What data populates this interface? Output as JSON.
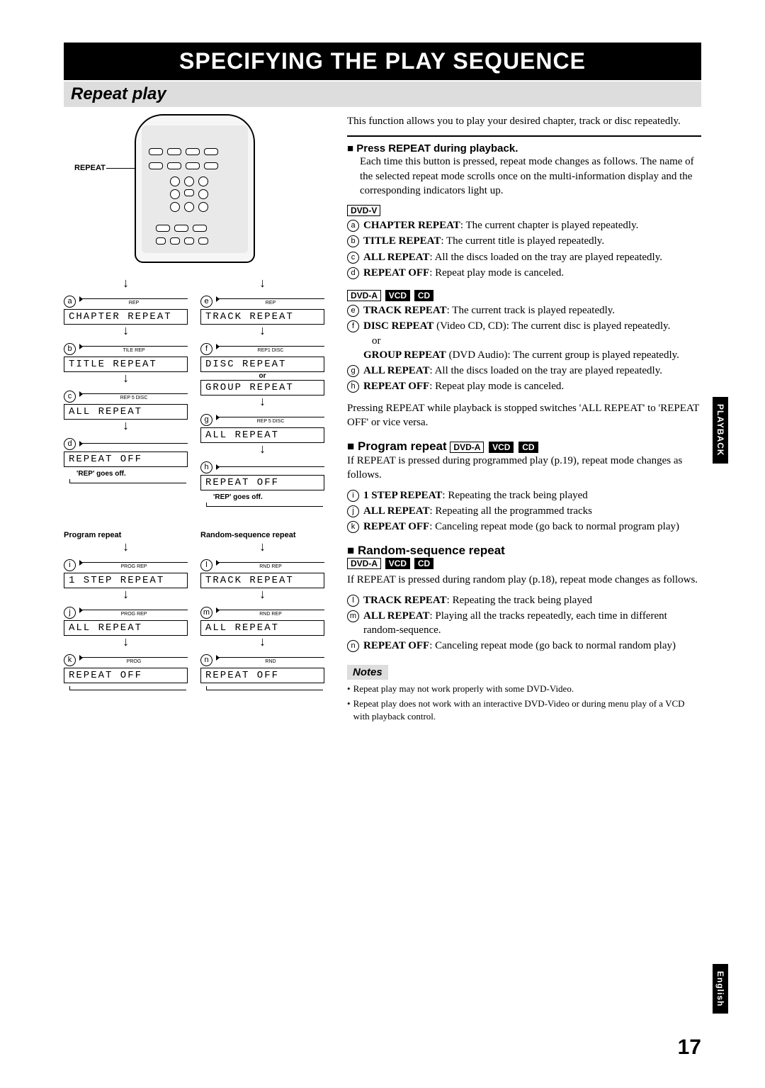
{
  "header": {
    "title": "SPECIFYING THE PLAY SEQUENCE"
  },
  "section": {
    "title": "Repeat play"
  },
  "remote": {
    "label": "REPEAT"
  },
  "flows": {
    "left1": {
      "a": "CHAPTER REPEAT",
      "b": "TITLE REPEAT",
      "c": "ALL REPEAT",
      "d": "REPEAT OFF",
      "off_note": "'REP' goes off.",
      "ind_a": "REP",
      "ind_b": "TILE       REP",
      "ind_c": "REP  5 DISC",
      "ind_d": ""
    },
    "right1": {
      "e": "TRACK REPEAT",
      "f": "DISC REPEAT",
      "f2_label": "or",
      "f2": "GROUP REPEAT",
      "g": "ALL REPEAT",
      "h": "REPEAT OFF",
      "off_note": "'REP' goes off.",
      "ind_e": "REP",
      "ind_f": "REP1  DISC",
      "ind_g": "REP  5 DISC",
      "ind_h": ""
    },
    "prog": {
      "title": "Program repeat",
      "i": "1 STEP REPEAT",
      "j": "ALL REPEAT",
      "k": "REPEAT OFF",
      "ind_i": "PROG    REP",
      "ind_j": "PROG    REP",
      "ind_k": "PROG"
    },
    "rnd": {
      "title": "Random-sequence repeat",
      "l": "TRACK REPEAT",
      "m": "ALL REPEAT",
      "n": "REPEAT OFF",
      "ind_l": "RND  REP",
      "ind_m": "RND  REP",
      "ind_n": "RND"
    }
  },
  "right": {
    "intro": "This function allows you to play your desired chapter, track or disc repeatedly.",
    "step_title": "Press REPEAT during playback.",
    "step_body": "Each time this button is pressed, repeat mode changes as follows. The name of the selected repeat mode scrolls once on the multi-information display and the corresponding indicators light up.",
    "formats": {
      "dvdv": "DVD-V",
      "dvda": "DVD-A",
      "vcd": "VCD",
      "cd": "CD"
    },
    "dvdv": {
      "a": {
        "label": "CHAPTER REPEAT",
        "desc": ": The current chapter is played repeatedly."
      },
      "b": {
        "label": "TITLE REPEAT",
        "desc": ": The current title is played repeatedly."
      },
      "c": {
        "label": "ALL REPEAT",
        "desc": ": All the discs loaded on the tray are played repeatedly."
      },
      "d": {
        "label": "REPEAT OFF",
        "desc": ": Repeat play mode is canceled."
      }
    },
    "dvda": {
      "e": {
        "label": "TRACK REPEAT",
        "desc": ": The current track is played repeat­edly."
      },
      "f": {
        "label": "DISC REPEAT",
        "desc": " (Video CD, CD): The current disc is played repeatedly."
      },
      "f_or": "or",
      "f2": {
        "label": "GROUP REPEAT",
        "desc": " (DVD Audio): The current group is played repeatedly."
      },
      "g": {
        "label": "ALL REPEAT",
        "desc": ": All the discs loaded on the tray are played repeatedly."
      },
      "h": {
        "label": "REPEAT OFF",
        "desc": ": Repeat play mode is canceled."
      }
    },
    "stop_note": "Pressing REPEAT while playback is stopped switches 'ALL REPEAT' to 'REPEAT OFF' or vice versa.",
    "program": {
      "title": "Program repeat",
      "intro": "If REPEAT is pressed during programmed play (p.19), repeat mode changes as follows.",
      "i": {
        "label": "1 STEP REPEAT",
        "desc": ": Repeating the track being played"
      },
      "j": {
        "label": "ALL REPEAT",
        "desc": ": Repeating all the programmed tracks"
      },
      "k": {
        "label": "REPEAT OFF",
        "desc": ": Canceling repeat mode (go back to normal program play)"
      }
    },
    "random": {
      "title": "Random-sequence repeat",
      "intro": "If REPEAT is pressed during random play (p.18), repeat mode changes as follows.",
      "l": {
        "label": "TRACK REPEAT",
        "desc": ": Repeating the track being played"
      },
      "m": {
        "label": "ALL REPEAT",
        "desc": ": Playing all the tracks repeatedly, each time in different random-sequence."
      },
      "n": {
        "label": "REPEAT OFF",
        "desc": ": Canceling repeat mode (go back to normal random play)"
      }
    },
    "notes": {
      "title": "Notes",
      "n1": "Repeat play may not work properly with some DVD-Video.",
      "n2": "Repeat play does not work with an interactive DVD-Video or during menu play of a VCD with playback control."
    }
  },
  "side": {
    "tab1": "PLAYBACK",
    "tab2": "English"
  },
  "page_num": "17"
}
